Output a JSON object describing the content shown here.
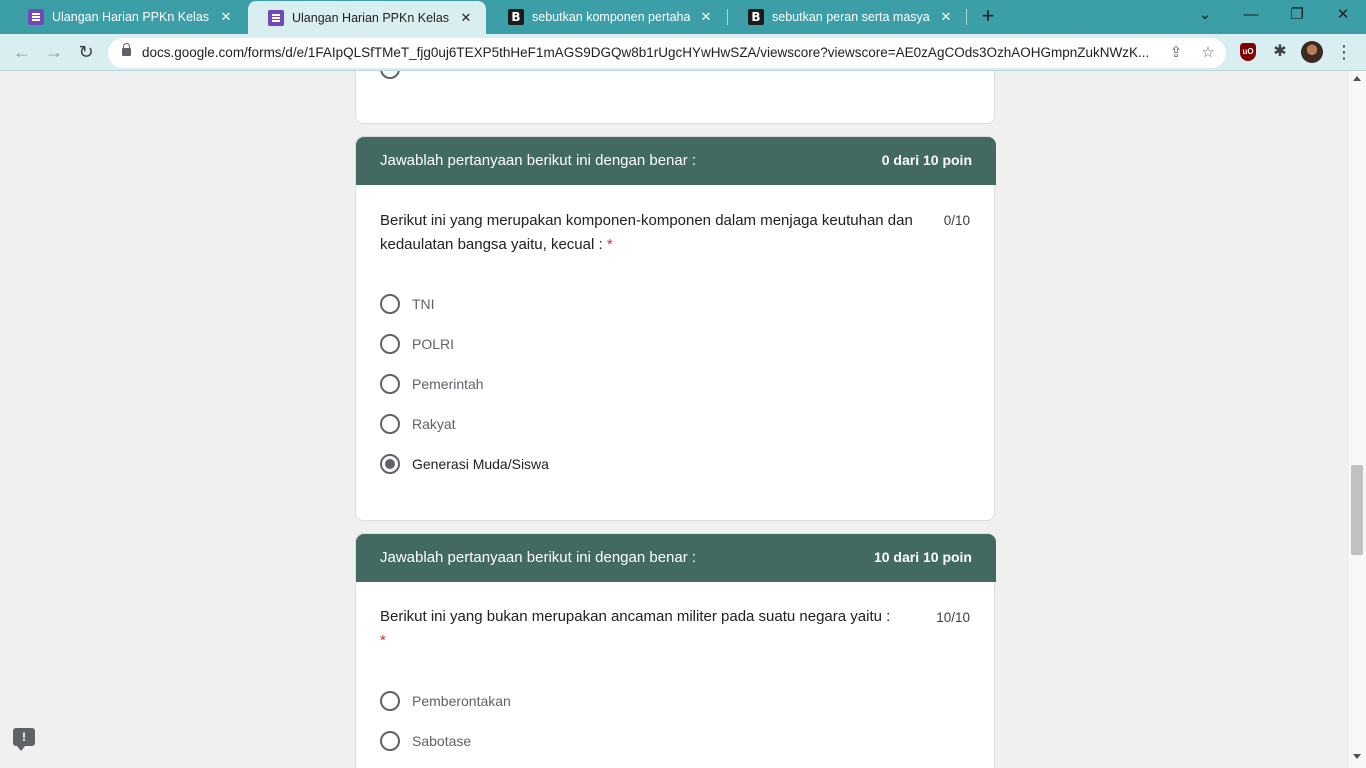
{
  "tabs": [
    {
      "title": "Ulangan Harian PPKn Kelas X-VI",
      "favicon": "google-forms-icon",
      "active": false
    },
    {
      "title": "Ulangan Harian PPKn Kelas X-VI",
      "favicon": "google-forms-icon",
      "active": true
    },
    {
      "title": "sebutkan komponen pertahanan",
      "favicon": "brainly-icon",
      "active": false
    },
    {
      "title": "sebutkan peran serta masyarakat",
      "favicon": "brainly-icon",
      "active": false
    }
  ],
  "tab_close_glyph": "✕",
  "new_tab_glyph": "+",
  "window_controls": {
    "menu": "⌄",
    "minimize": "—",
    "restore": "❐",
    "close": "✕"
  },
  "toolbar": {
    "back": "←",
    "forward": "→",
    "reload": "↻",
    "url": "docs.google.com/forms/d/e/1FAIpQLSfTMeT_fjg0uj6TEXP5thHeF1mAGS9DGQw8b1rUgcHYwHwSZA/viewscore?viewscore=AE0zAgCOds3OzhAOHGmpnZukNWzK..."
  },
  "extensions": {
    "ublock": "uO",
    "puzzle": "✱",
    "menu": "⋮"
  },
  "cards": [
    {
      "header_title": "Jawablah pertanyaan berikut ini dengan benar :",
      "header_score": "0 dari 10 poin",
      "question": "Berikut ini yang merupakan komponen-komponen dalam menjaga keutuhan dan kedaulatan bangsa yaitu, kecual :",
      "required_mark": "*",
      "score": "0/10",
      "options": [
        {
          "label": "TNI",
          "selected": false
        },
        {
          "label": "POLRI",
          "selected": false
        },
        {
          "label": "Pemerintah",
          "selected": false
        },
        {
          "label": "Rakyat",
          "selected": false
        },
        {
          "label": "Generasi Muda/Siswa",
          "selected": true
        }
      ]
    },
    {
      "header_title": "Jawablah pertanyaan berikut ini dengan benar :",
      "header_score": "10 dari 10 poin",
      "question": "Berikut ini yang bukan merupakan ancaman militer pada suatu negara yaitu :",
      "required_mark": "*",
      "score": "10/10",
      "options": [
        {
          "label": "Pemberontakan",
          "selected": false
        },
        {
          "label": "Sabotase",
          "selected": false
        }
      ]
    }
  ],
  "report_icon": "!",
  "colors": {
    "tabstrip": "#3c9fa8",
    "toolbar": "#d9eef0",
    "card_header": "#426a60",
    "required": "#d93025"
  }
}
